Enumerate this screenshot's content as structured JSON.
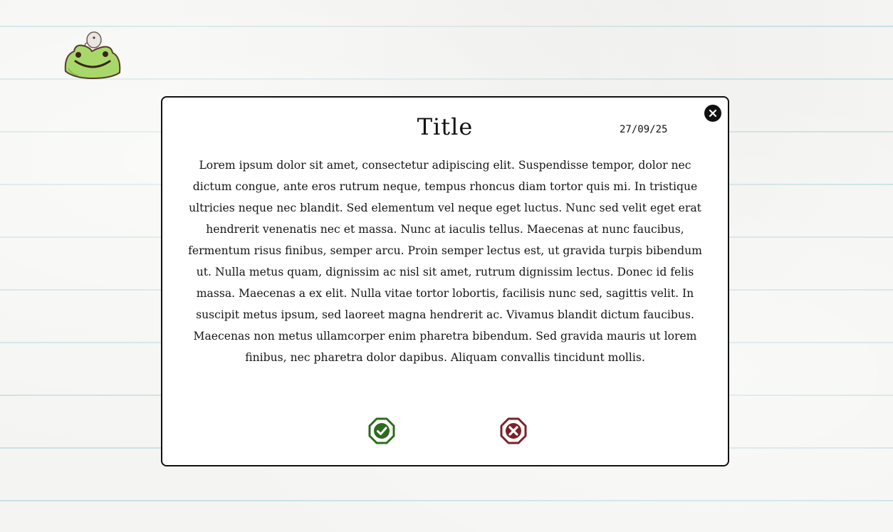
{
  "logo": {
    "icon": "frog-icon"
  },
  "modal": {
    "title": "Title",
    "date": "27/09/25",
    "body": "Lorem ipsum dolor sit amet, consectetur adipiscing elit. Suspendisse tempor, dolor nec dictum congue, ante eros rutrum neque, tempus rhoncus diam tortor quis mi. In tristique ultricies neque nec blandit. Sed elementum vel neque eget luctus. Nunc sed velit eget erat hendrerit venenatis nec et massa. Nunc at iaculis tellus. Maecenas at nunc faucibus, fermentum risus finibus, semper arcu. Proin semper lectus est, ut gravida turpis bibendum ut. Nulla metus quam, dignissim ac nisl sit amet, rutrum dignissim lectus. Donec id felis massa. Maecenas a ex elit. Nulla vitae tortor lobortis, facilisis nunc sed, sagittis velit. In suscipit metus ipsum, sed laoreet magna hendrerit ac. Vivamus blandit dictum faucibus. Maecenas non metus ullamcorper enim pharetra bibendum. Sed gravida mauris ut lorem finibus, nec pharetra dolor dapibus. Aliquam convallis tincidunt mollis.",
    "close_icon": "close-icon",
    "confirm_icon": "check-icon",
    "cancel_icon": "x-icon"
  },
  "colors": {
    "confirm": "#2d6a1f",
    "cancel": "#7a2228",
    "frog": "#a9d86a",
    "line": "#c8e0e3"
  }
}
